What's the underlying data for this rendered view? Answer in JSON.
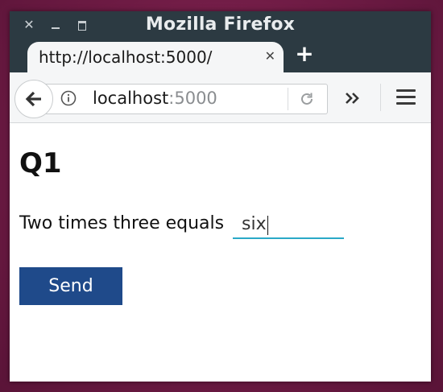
{
  "window": {
    "title": "Mozilla Firefox",
    "close_glyph": "✕"
  },
  "tab": {
    "title": "http://localhost:5000/",
    "close_glyph": "✕",
    "new_tab_glyph": "+"
  },
  "navbar": {
    "url_host": "localhost",
    "url_port": ":5000"
  },
  "page": {
    "heading": "Q1",
    "question": "Two times three equals",
    "answer_value": "six",
    "submit_label": "Send"
  },
  "colors": {
    "titlebar_bg": "#2c3a42",
    "toolbar_bg": "#f5f6f7",
    "input_underline": "#2aa9c7",
    "button_bg": "#1f4a8a",
    "desktop_bg": "#7a1f4a"
  },
  "icons": {
    "close": "close-icon",
    "minimize": "minimize-icon",
    "maximize": "maximize-icon",
    "back": "back-arrow-icon",
    "info": "info-icon",
    "reload": "reload-icon",
    "overflow": "chevron-double-right-icon",
    "menu": "hamburger-menu-icon"
  }
}
